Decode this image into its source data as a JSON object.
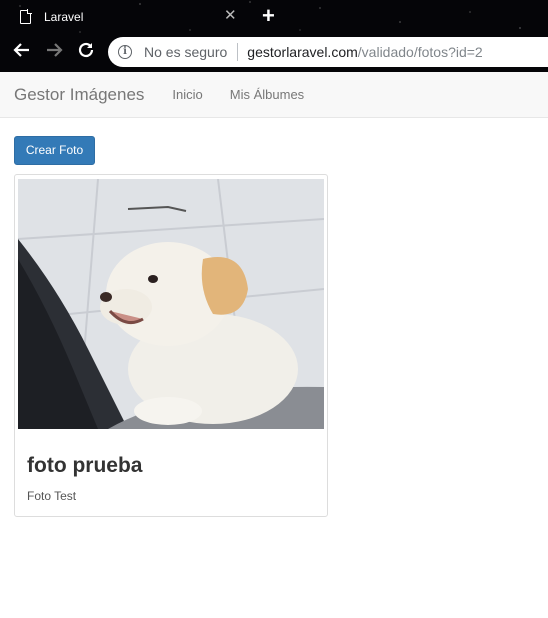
{
  "browser": {
    "tab_title": "Laravel",
    "security_label": "No es seguro",
    "url_host": "gestorlaravel.com",
    "url_path": "/validado/fotos?id=2"
  },
  "navbar": {
    "brand": "Gestor Imágenes",
    "links": [
      "Inicio",
      "Mis Álbumes"
    ]
  },
  "actions": {
    "create_photo": "Crear Foto"
  },
  "photos": [
    {
      "title": "foto prueba",
      "description": "Foto Test",
      "image_subject": "puppy on tiled floor"
    }
  ],
  "colors": {
    "primary_button": "#337ab7",
    "navbar_bg": "#f8f8f8",
    "browser_chrome": "#050508"
  }
}
